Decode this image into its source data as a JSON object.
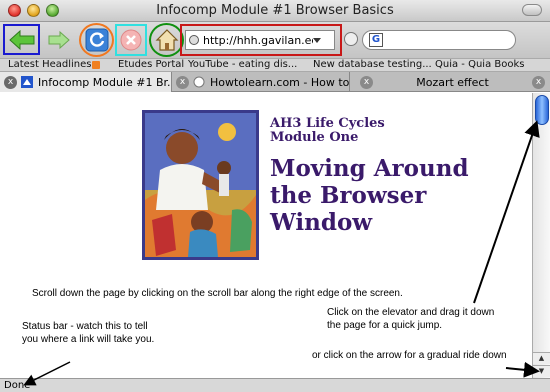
{
  "window": {
    "title": "Infocomp Module #1 Browser Basics"
  },
  "toolbar": {
    "back_icon": "back-arrow-icon",
    "forward_icon": "forward-arrow-icon",
    "reload_icon": "reload-icon",
    "stop_icon": "stop-icon",
    "home_icon": "home-icon",
    "url": "http://hhh.gavilan.edu",
    "search_engine_icon": "G",
    "colors": {
      "back_highlight": "#1a1ad0",
      "reload_highlight": "#f07820",
      "stop_highlight": "#30e0e0",
      "home_highlight": "#109010",
      "url_highlight": "#c81818"
    }
  },
  "bookmarks": [
    {
      "label": "Latest Headlines"
    },
    {
      "label": "Etudes Portal"
    },
    {
      "label": "YouTube - eating dis..."
    },
    {
      "label": "New database testing..."
    },
    {
      "label": "Quia - Quia Books"
    }
  ],
  "tabs": [
    {
      "label": "Infocomp Module #1 Br...",
      "active": true
    },
    {
      "label": "Howtolearn.com - How to ...",
      "active": false
    },
    {
      "label": "Mozart effect",
      "active": false
    }
  ],
  "page": {
    "subheading_line1": "AH3 Life Cycles",
    "subheading_line2": "Module One",
    "heading_line1": "Moving Around",
    "heading_line2": "the Browser",
    "heading_line3": "Window",
    "heading_color": "#3a1a6a"
  },
  "annotations": {
    "scroll_instruction": "Scroll down the page by clicking on the scroll bar along the right edge of the screen.",
    "status_note_line1": "Status bar - watch this to tell",
    "status_note_line2": "you where a link will take you.",
    "elevator_note_line1": "Click on the elevator and drag it down",
    "elevator_note_line2": "the page for a quick jump.",
    "arrow_note": "or click on the arrow for a gradual ride down"
  },
  "statusbar": {
    "text": "Done"
  }
}
